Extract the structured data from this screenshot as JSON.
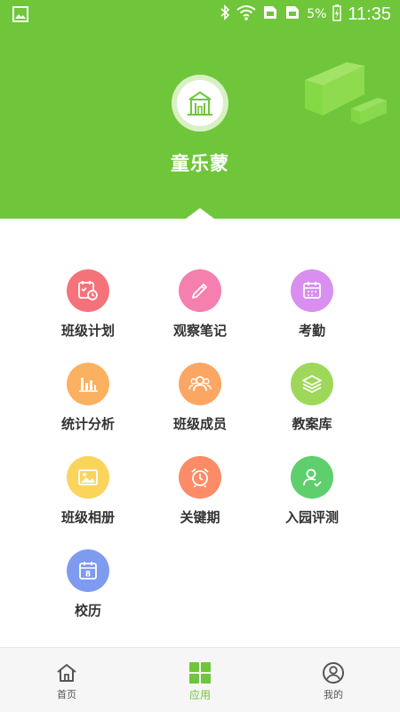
{
  "status_bar": {
    "battery": "5%",
    "time": "11:35"
  },
  "header": {
    "title": "童乐蒙"
  },
  "colors": {
    "brand": "#6fc63a",
    "tab_active": "#6fc63a",
    "tab_inactive": "#555555"
  },
  "grid": {
    "items": [
      {
        "label": "班级计划",
        "icon": "calendar-clock-icon",
        "color": "#f6727a"
      },
      {
        "label": "观察笔记",
        "icon": "pencil-icon",
        "color": "#f57fae"
      },
      {
        "label": "考勤",
        "icon": "calendar-check-icon",
        "color": "#d88fef"
      },
      {
        "label": "统计分析",
        "icon": "bar-chart-icon",
        "color": "#fcb161"
      },
      {
        "label": "班级成员",
        "icon": "group-icon",
        "color": "#fca663"
      },
      {
        "label": "教案库",
        "icon": "layers-icon",
        "color": "#9ed85a"
      },
      {
        "label": "班级相册",
        "icon": "image-icon",
        "color": "#fbd45c"
      },
      {
        "label": "关键期",
        "icon": "alarm-clock-icon",
        "color": "#fc8c67"
      },
      {
        "label": "入园评测",
        "icon": "user-check-icon",
        "color": "#5fcf6e"
      },
      {
        "label": "校历",
        "icon": "calendar-icon",
        "color": "#7f9bf0"
      }
    ]
  },
  "tabs": [
    {
      "label": "首页",
      "icon": "home-icon"
    },
    {
      "label": "应用",
      "icon": "grid-icon"
    },
    {
      "label": "我的",
      "icon": "user-icon"
    }
  ]
}
